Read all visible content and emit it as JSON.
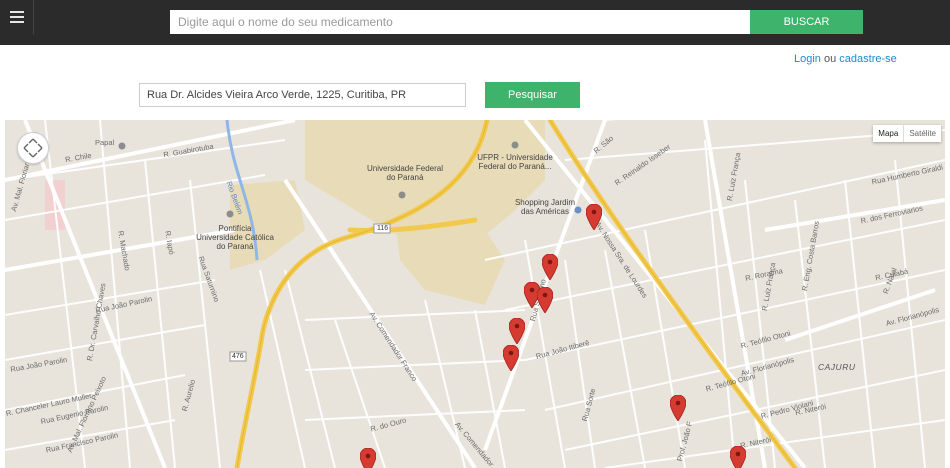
{
  "header": {
    "search_placeholder": "Digite aqui o nome do seu medicamento",
    "search_button": "BUSCAR"
  },
  "auth": {
    "login": "Login",
    "separator": "ou",
    "signup": "cadastre-se"
  },
  "address": {
    "value": "Rua Dr. Alcides Vieira Arco Verde, 1225, Curitiba, PR",
    "button": "Pesquisar"
  },
  "map": {
    "type_options": [
      "Mapa",
      "Satélite"
    ],
    "accent_pin_color": "#d63b31",
    "road_major_color": "#f2c94c",
    "labels": {
      "chile": "R. Chile",
      "papa": "Papal",
      "guabirotuba": "R. Guabirotuba",
      "floriano": "Av. Mal. Floriano Peixoto",
      "floriano2": "Av. Mal. Floriano Peixoto",
      "belem": "Rio Belém",
      "pucpr": "Pontifícia Universidade Católica do Paraná",
      "ufpr1": "Universidade Federal do Paraná",
      "ufpr2": "UFPR - Universidade Federal do Paraná...",
      "shopping": "Shopping Jardim das Américas",
      "comendador": "Av. Comendador Franco",
      "comendador2": "Av. Comendador",
      "nossa": "Av. Nossa Sra. de Lourdes",
      "ferroviarios": "R. dos Ferroviarios",
      "luiz": "R. Luiz França",
      "luiz2": "R. Luiz França",
      "engcosta": "R. Eng. Costa Barros",
      "cajuru": "CAJURU",
      "reinaldo": "R. Reinaldo Isseber",
      "parolin": "Rua João Parolin",
      "parolin2": "Rua João Parolin",
      "carvalho": "R. Dr. Carvalho Chaves",
      "eugenio": "Rua Eugenio Parolin",
      "chancelor": "R. Chanceler Lauro Muller",
      "francisco": "Rua Francisco Parolin",
      "teofilo": "R. Teófilo Otoni",
      "teofilo2": "R. Teófilo Otoni",
      "floria": "Av. Florianópolis",
      "floria2": "Av. Florianópolis",
      "roraima": "R. Roraima",
      "niteroi": "R. Niterói",
      "niteroi2": "R. Niterói",
      "sandimas": "Rua Sandino",
      "joao": "Rua João Itiberê",
      "jusa": "Rua Sorte",
      "ouro": "R. do Ouro",
      "aurelio": "R. Aurelio",
      "machado": "R. Machado",
      "iapo": "R. Iapó",
      "saturnino": "Rua Saturnino",
      "pedrovialiani": "R. Pedro Violani",
      "prof": "Prof. João F",
      "r116": "116",
      "r476": "476",
      "humberto": "Rua Humberto Giraldi",
      "cuiaba": "R. Cuiabá",
      "natal": "R. Natal",
      "sao": "R. São"
    }
  }
}
